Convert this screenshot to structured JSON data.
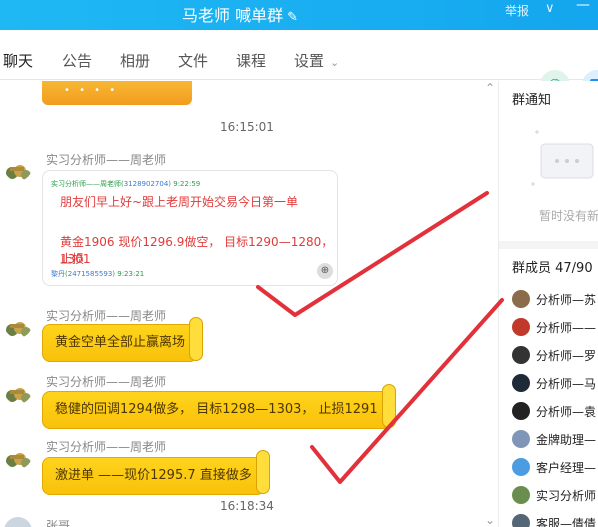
{
  "window": {
    "title": "马老师 喊单群",
    "report_label": "举报",
    "edit_icon": "pencil-icon",
    "menu_icon": "chevron-down-icon"
  },
  "tabs": [
    {
      "label": "聊天",
      "active": true
    },
    {
      "label": "公告"
    },
    {
      "label": "相册"
    },
    {
      "label": "文件"
    },
    {
      "label": "课程"
    },
    {
      "label": "设置"
    }
  ],
  "actions": {
    "call_icon": "phone-icon",
    "share_icon": "share-icon"
  },
  "messages": {
    "time1": "16:15:01",
    "sender": "实习分析师——周老师",
    "card": {
      "meta1_name": "实习分析师——周老师",
      "meta1_id": "3128902704",
      "meta1_time": "9:22:59",
      "line1": "朋友们早上好~跟上老周开始交易今日第一单",
      "line2": "黄金1906 现价1296.9做空， 目标1290—1280，止损",
      "line3": "1301",
      "meta2_name": "黎丹",
      "meta2_id": "2471585593",
      "meta2_time": "9:23:21"
    },
    "bubble1": "黄金空单全部止赢离场",
    "bubble2": "稳健的回调1294做多， 目标1298—1303， 止损1291",
    "bubble3": "激进单 ——现价1295.7 直接做多",
    "time2": "16:18:34",
    "partial_sender": "张哥"
  },
  "panel": {
    "notice_title": "群通知",
    "notice_empty": "暂时没有新",
    "members_title": "群成员 47/90",
    "members": [
      {
        "name": "分析师—苏",
        "color": "#8a6b4a"
      },
      {
        "name": "分析师——",
        "color": "#c0392b"
      },
      {
        "name": "分析师—罗",
        "color": "#333333"
      },
      {
        "name": "分析师—马",
        "color": "#1f2a38"
      },
      {
        "name": "分析师—袁",
        "color": "#222222"
      },
      {
        "name": "金牌助理—",
        "color": "#7f96b8"
      },
      {
        "name": "客户经理—",
        "color": "#4b9ce0"
      },
      {
        "name": "实习分析师",
        "color": "#6b8e4e"
      },
      {
        "name": "客服—倩倩",
        "color": "#556677"
      }
    ]
  }
}
